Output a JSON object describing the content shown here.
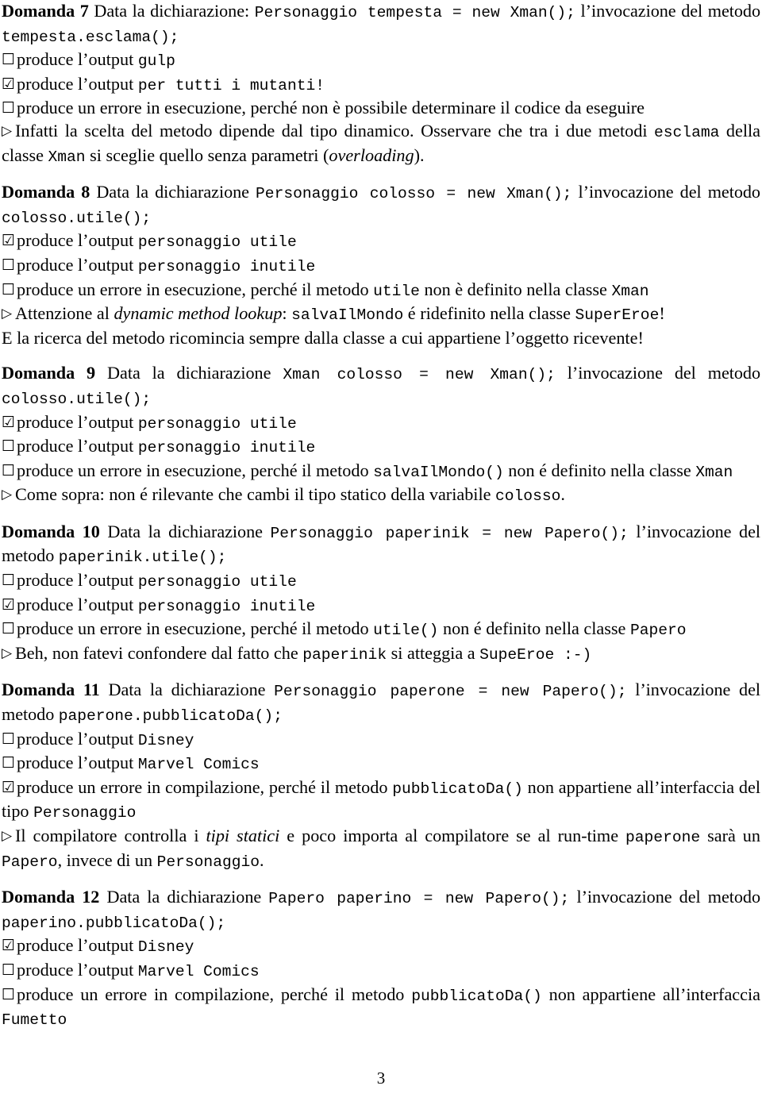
{
  "document": {
    "page_number": "3",
    "language": "it",
    "icons": {
      "checkbox_empty": "☐",
      "checkbox_checked": "☑",
      "note_bullet": "▷"
    }
  },
  "questions": [
    {
      "id": "domanda-7",
      "number_label": "Domanda 7",
      "intro_lead": " Data la dichiarazione: ",
      "intro_code": "Personaggio tempesta = new Xman();",
      "intro_tail": " l’invocazione del metodo ",
      "intro_code2": "tempesta.esclama();",
      "options": [
        {
          "checked": false,
          "lead": "produce l’output ",
          "code": "gulp",
          "tail": ""
        },
        {
          "checked": true,
          "lead": "produce l’output ",
          "code": "per tutti i mutanti!",
          "tail": ""
        },
        {
          "checked": false,
          "lead": "produce un errore in esecuzione, perché non è possibile determinare il codice da eseguire",
          "code": "",
          "tail": ""
        }
      ],
      "note": {
        "part1": "Infatti la scelta del metodo dipende dal tipo dinamico. Osservare che tra i due metodi ",
        "code1": "esclama",
        "part2": " della classe ",
        "code2": "Xman",
        "part3": " si sceglie quello senza parametri (",
        "italic1": "overloading",
        "part4": ")."
      }
    },
    {
      "id": "domanda-8",
      "number_label": "Domanda 8",
      "intro_lead": " Data la dichiarazione ",
      "intro_code": "Personaggio colosso = new Xman();",
      "intro_tail": " l’invocazione del metodo ",
      "intro_code2": "colosso.utile();",
      "options": [
        {
          "checked": true,
          "lead": "produce l’output ",
          "code": "personaggio utile",
          "tail": ""
        },
        {
          "checked": false,
          "lead": "produce l’output ",
          "code": "personaggio inutile",
          "tail": ""
        },
        {
          "checked": false,
          "lead": "produce un errore in esecuzione, perché il metodo ",
          "code": "utile",
          "tail": " non è definito nella classe ",
          "code2": "Xman"
        }
      ],
      "note": {
        "part1": "Attenzione al ",
        "italic1": "dynamic method lookup",
        "part2": ": ",
        "code1": "salvaIlMondo",
        "part3": " é ridefinito nella classe ",
        "code2": "SuperEroe",
        "part4": "!",
        "line2": "E la ricerca del metodo ricomincia sempre dalla classe a cui appartiene l’oggetto ricevente!"
      }
    },
    {
      "id": "domanda-9",
      "number_label": "Domanda 9",
      "intro_lead": " Data la dichiarazione ",
      "intro_code": "Xman colosso = new Xman();",
      "intro_tail": " l’invocazione del metodo ",
      "intro_code2": "colosso.utile();",
      "options": [
        {
          "checked": true,
          "lead": "produce l’output ",
          "code": "personaggio utile",
          "tail": ""
        },
        {
          "checked": false,
          "lead": "produce l’output ",
          "code": "personaggio inutile",
          "tail": ""
        },
        {
          "checked": false,
          "lead": "produce un errore in esecuzione, perché il metodo ",
          "code": "salvaIlMondo()",
          "tail": " non é definito nella classe ",
          "code2": "Xman"
        }
      ],
      "note": {
        "part1": "Come sopra: non é rilevante che cambi il tipo statico della variabile ",
        "code1": "colosso",
        "part2": "."
      }
    },
    {
      "id": "domanda-10",
      "number_label": "Domanda 10",
      "intro_lead": " Data la dichiarazione ",
      "intro_code": "Personaggio paperinik = new Papero();",
      "intro_tail": " l’invocazione del metodo ",
      "intro_code2": "paperinik.utile();",
      "options": [
        {
          "checked": false,
          "lead": "produce l’output ",
          "code": "personaggio utile",
          "tail": ""
        },
        {
          "checked": true,
          "lead": "produce l’output ",
          "code": "personaggio inutile",
          "tail": ""
        },
        {
          "checked": false,
          "lead": "produce un errore in esecuzione, perché il metodo ",
          "code": "utile()",
          "tail": " non é definito nella classe ",
          "code2": "Papero"
        }
      ],
      "note": {
        "part1": "Beh, non fatevi confondere dal fatto che ",
        "code1": "paperinik",
        "part2": " si atteggia a ",
        "code2": "SupeEroe :-)",
        "part3": ""
      }
    },
    {
      "id": "domanda-11",
      "number_label": "Domanda 11",
      "intro_lead": " Data la dichiarazione ",
      "intro_code": "Personaggio paperone = new Papero();",
      "intro_tail": " l’invocazione del metodo ",
      "intro_code2": "paperone.pubblicatoDa();",
      "options": [
        {
          "checked": false,
          "lead": "produce l’output ",
          "code": "Disney",
          "tail": ""
        },
        {
          "checked": false,
          "lead": "produce l’output ",
          "code": "Marvel Comics",
          "tail": ""
        },
        {
          "checked": true,
          "lead": "produce un errore in compilazione, perché il metodo ",
          "code": "pubblicatoDa()",
          "tail": " non appartiene all’interfaccia del tipo ",
          "code2": "Personaggio"
        }
      ],
      "note": {
        "part1": "Il compilatore controlla i ",
        "italic1": "tipi statici",
        "part2": " e poco importa al compilatore se al run-time ",
        "code1": "paperone",
        "part3": " sarà un ",
        "code2": "Papero",
        "part4": ", invece di un ",
        "code3": "Personaggio",
        "part5": "."
      }
    },
    {
      "id": "domanda-12",
      "number_label": "Domanda 12",
      "intro_lead": " Data la dichiarazione ",
      "intro_code": "Papero paperino = new Papero();",
      "intro_tail": " l’invocazione del metodo ",
      "intro_code2": "paperino.pubblicatoDa();",
      "options": [
        {
          "checked": true,
          "lead": "produce l’output ",
          "code": "Disney",
          "tail": ""
        },
        {
          "checked": false,
          "lead": "produce l’output ",
          "code": "Marvel Comics",
          "tail": ""
        },
        {
          "checked": false,
          "lead": "produce un errore in compilazione, perché il metodo ",
          "code": "pubblicatoDa()",
          "tail": " non appartiene all’interfaccia ",
          "code2": "Fumetto"
        }
      ],
      "note": null
    }
  ]
}
